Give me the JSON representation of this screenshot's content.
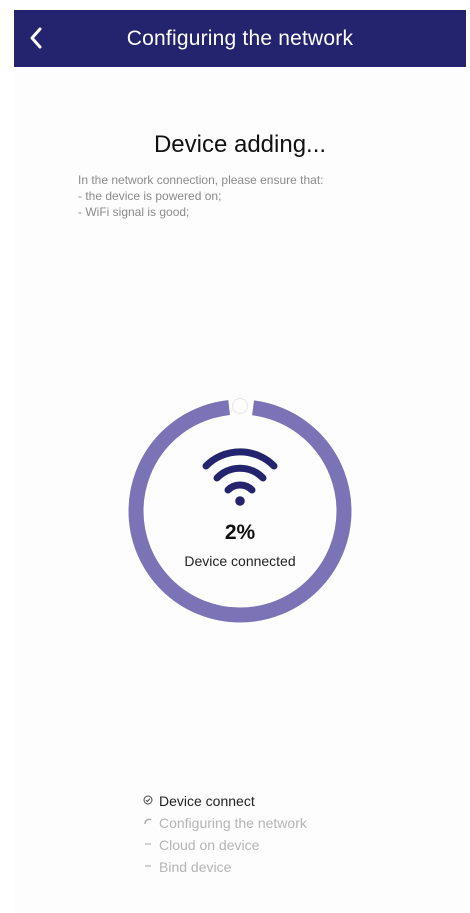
{
  "header": {
    "title": "Configuring the network"
  },
  "main": {
    "title": "Device adding...",
    "notice": [
      "In the network connection, please ensure that:",
      "- the device is powered on;",
      "- WiFi signal is good;"
    ]
  },
  "progress": {
    "percent": 0.02,
    "percent_label": "2%",
    "status": "Device connected"
  },
  "steps": [
    {
      "label": "Device connect",
      "icon": "check-circle-icon",
      "state": "done"
    },
    {
      "label": "Configuring the network",
      "icon": "spinner-icon",
      "state": "pending"
    },
    {
      "label": "Cloud on device",
      "icon": "dot-icon",
      "state": "pending"
    },
    {
      "label": "Bind device",
      "icon": "dot-icon",
      "state": "pending"
    }
  ],
  "colors": {
    "header_bg": "#24236d",
    "ring": "#7b73b5",
    "wifi": "#24236d"
  }
}
